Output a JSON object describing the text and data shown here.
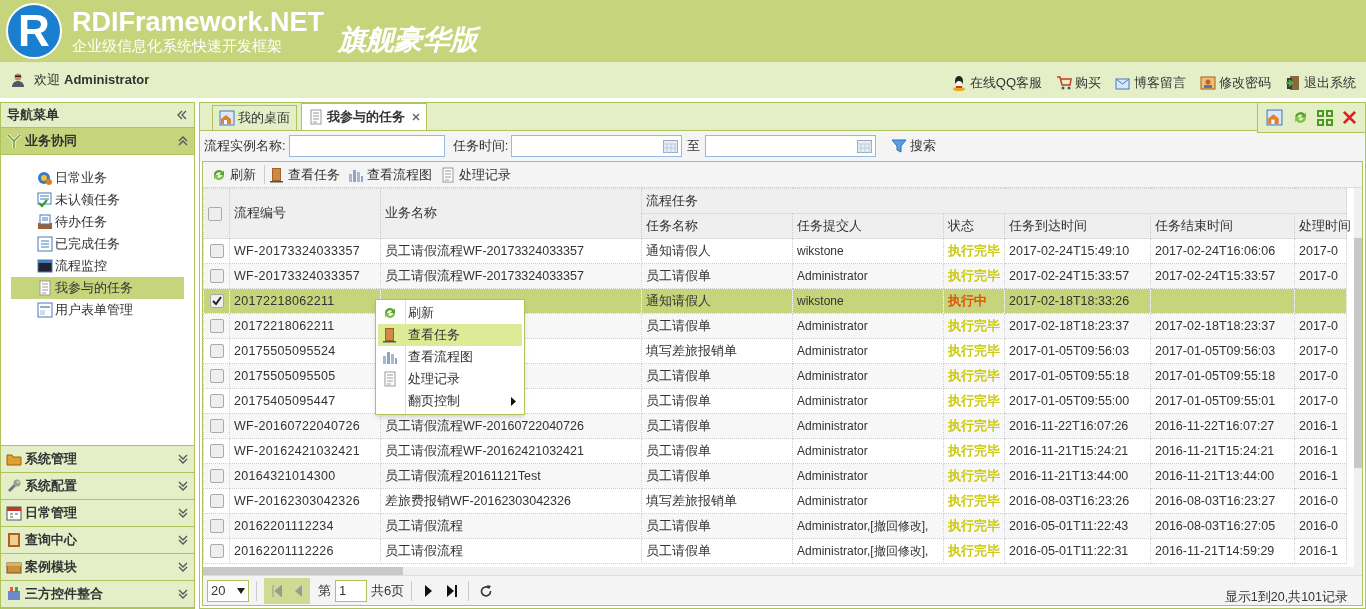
{
  "header": {
    "logo_mark": "R",
    "product": "RDIFramework.NET",
    "subtitle": "企业级信息化系统快速开发框架",
    "edition": "旗舰豪华版"
  },
  "user_bar": {
    "welcome": "欢迎",
    "user": "Administrator",
    "links": [
      "在线QQ客服",
      "购买",
      "博客留言",
      "修改密码",
      "退出系统"
    ]
  },
  "sidebar": {
    "title": "导航菜单",
    "sections": [
      {
        "label": "业务协同",
        "expanded": true,
        "items": [
          {
            "label": "日常业务",
            "selected": false
          },
          {
            "label": "未认领任务",
            "selected": false
          },
          {
            "label": "待办任务",
            "selected": false
          },
          {
            "label": "已完成任务",
            "selected": false
          },
          {
            "label": "流程监控",
            "selected": false
          },
          {
            "label": "我参与的任务",
            "selected": true
          },
          {
            "label": "用户表单管理",
            "selected": false
          }
        ]
      },
      {
        "label": "系统管理",
        "expanded": false
      },
      {
        "label": "系统配置",
        "expanded": false
      },
      {
        "label": "日常管理",
        "expanded": false
      },
      {
        "label": "查询中心",
        "expanded": false
      },
      {
        "label": "案例模块",
        "expanded": false
      },
      {
        "label": "三方控件整合",
        "expanded": false
      }
    ]
  },
  "tabs": [
    {
      "label": "我的桌面",
      "selected": false,
      "closable": false
    },
    {
      "label": "我参与的任务",
      "selected": true,
      "closable": true
    }
  ],
  "search": {
    "name_label": "流程实例名称:",
    "time_label": "任务时间:",
    "to_label": "至",
    "button": "搜索"
  },
  "toolbar": [
    "刷新",
    "查看任务",
    "查看流程图",
    "处理记录"
  ],
  "table": {
    "all_checked": false,
    "group_header": "流程任务",
    "columns": [
      "流程编号",
      "业务名称",
      "任务名称",
      "任务提交人",
      "状态",
      "任务到达时间",
      "任务结束时间",
      "处理时间"
    ],
    "rows": [
      {
        "checked": false,
        "selected": false,
        "id": "WF-20173324033357",
        "business": "员工请假流程WF-20173324033357",
        "task": "通知请假人",
        "submitter": "wikstone",
        "status": "执行完毕",
        "color": "#c8c800",
        "arrive": "2017-02-24T15:49:10",
        "end": "2017-02-24T16:06:06",
        "handle": "2017-0"
      },
      {
        "checked": false,
        "selected": false,
        "id": "WF-20173324033357",
        "business": "员工请假流程WF-20173324033357",
        "task": "员工请假单",
        "submitter": "Administrator",
        "status": "执行完毕",
        "color": "#c8c800",
        "arrive": "2017-02-24T15:33:57",
        "end": "2017-02-24T15:33:57",
        "handle": "2017-0"
      },
      {
        "checked": true,
        "selected": true,
        "id": "20172218062211",
        "task": "通知请假人",
        "submitter": "wikstone",
        "status": "执行中",
        "color": "#e05000",
        "arrive": "2017-02-18T18:33:26"
      },
      {
        "checked": false,
        "selected": false,
        "id": "20172218062211",
        "task": "员工请假单",
        "submitter": "Administrator",
        "status": "执行完毕",
        "color": "#c8c800",
        "arrive": "2017-02-18T18:23:37",
        "end": "2017-02-18T18:23:37",
        "handle": "2017-0"
      },
      {
        "checked": false,
        "selected": false,
        "id": "20175505095524",
        "task": "填写差旅报销单",
        "submitter": "Administrator",
        "status": "执行完毕",
        "color": "#c8c800",
        "arrive": "2017-01-05T09:56:03",
        "end": "2017-01-05T09:56:03",
        "handle": "2017-0"
      },
      {
        "checked": false,
        "selected": false,
        "id": "20175505095505",
        "task": "员工请假单",
        "submitter": "Administrator",
        "status": "执行完毕",
        "color": "#c8c800",
        "arrive": "2017-01-05T09:55:18",
        "end": "2017-01-05T09:55:18",
        "handle": "2017-0"
      },
      {
        "checked": false,
        "selected": false,
        "id": "20175405095447",
        "task": "员工请假单",
        "submitter": "Administrator",
        "status": "执行完毕",
        "color": "#c8c800",
        "arrive": "2017-01-05T09:55:00",
        "end": "2017-01-05T09:55:01",
        "handle": "2017-0"
      },
      {
        "checked": false,
        "selected": false,
        "id": "WF-20160722040726",
        "business": "员工请假流程WF-20160722040726",
        "task": "员工请假单",
        "submitter": "Administrator",
        "status": "执行完毕",
        "color": "#c8c800",
        "arrive": "2016-11-22T16:07:26",
        "end": "2016-11-22T16:07:27",
        "handle": "2016-1"
      },
      {
        "checked": false,
        "selected": false,
        "id": "WF-20162421032421",
        "business": "员工请假流程WF-20162421032421",
        "task": "员工请假单",
        "submitter": "Administrator",
        "status": "执行完毕",
        "color": "#c8c800",
        "arrive": "2016-11-21T15:24:21",
        "end": "2016-11-21T15:24:21",
        "handle": "2016-1"
      },
      {
        "checked": false,
        "selected": false,
        "id": "20164321014300",
        "business": "员工请假流程20161121Test",
        "task": "员工请假单",
        "submitter": "Administrator",
        "status": "执行完毕",
        "color": "#c8c800",
        "arrive": "2016-11-21T13:44:00",
        "end": "2016-11-21T13:44:00",
        "handle": "2016-1"
      },
      {
        "checked": false,
        "selected": false,
        "id": "WF-20162303042326",
        "business": "差旅费报销WF-20162303042326",
        "task": "填写差旅报销单",
        "submitter": "Administrator",
        "status": "执行完毕",
        "color": "#c8c800",
        "arrive": "2016-08-03T16:23:26",
        "end": "2016-08-03T16:23:27",
        "handle": "2016-0"
      },
      {
        "checked": false,
        "selected": false,
        "id": "20162201112234",
        "business": "员工请假流程",
        "task": "员工请假单",
        "submitter": "Administrator,[撤回修改],",
        "status": "执行完毕",
        "color": "#c8c800",
        "arrive": "2016-05-01T11:22:43",
        "end": "2016-08-03T16:27:05",
        "handle": "2016-0"
      },
      {
        "checked": false,
        "selected": false,
        "id": "20162201112226",
        "business": "员工请假流程",
        "task": "员工请假单",
        "submitter": "Administrator,[撤回修改],",
        "status": "执行完毕",
        "color": "#c8c800",
        "arrive": "2016-05-01T11:22:31",
        "end": "2016-11-21T14:59:29",
        "handle": "2016-1"
      }
    ]
  },
  "context_menu": [
    {
      "label": "刷新",
      "selected": false,
      "submenu": false
    },
    {
      "label": "查看任务",
      "selected": true,
      "submenu": false
    },
    {
      "label": "查看流程图",
      "selected": false,
      "submenu": false
    },
    {
      "label": "处理记录",
      "selected": false,
      "submenu": false
    },
    {
      "label": "翻页控制",
      "selected": false,
      "submenu": true
    }
  ],
  "pager": {
    "page_size": "20",
    "page_label": "第",
    "page": "1",
    "total_label": "共6页",
    "summary": "显示1到20,共101记录"
  }
}
